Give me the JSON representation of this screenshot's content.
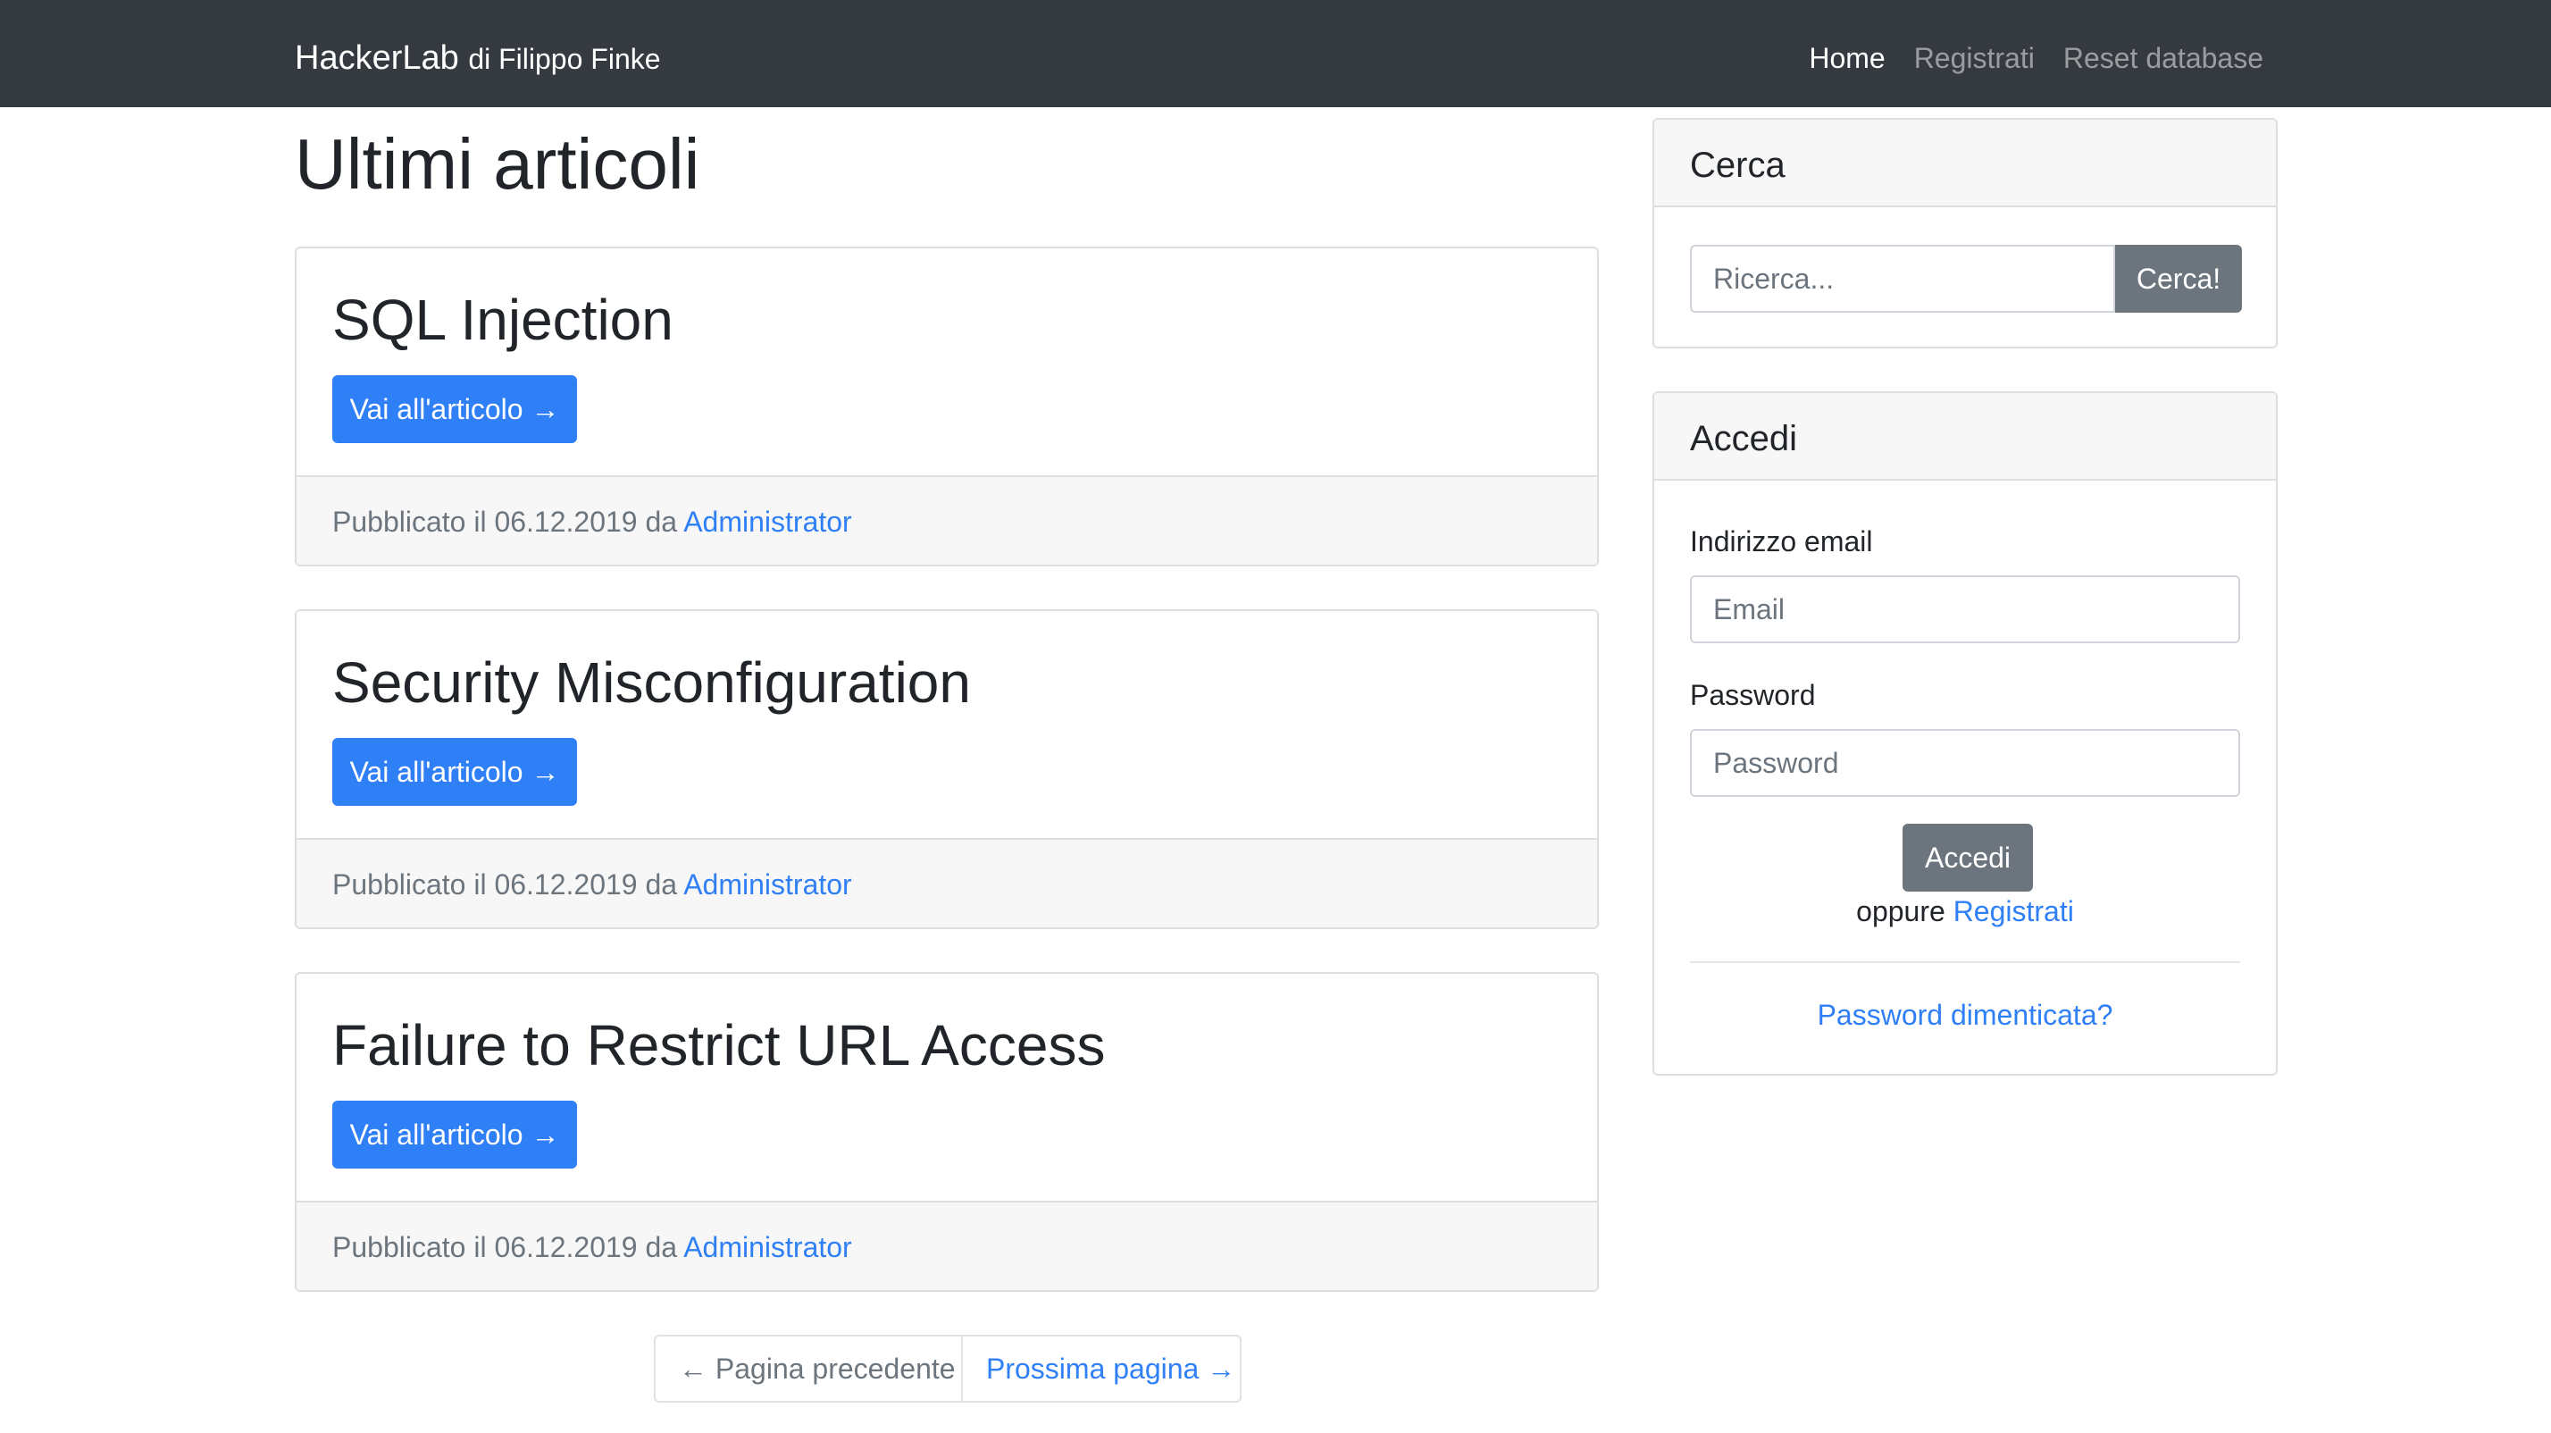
{
  "navbar": {
    "brand": "HackerLab",
    "brand_sub": "di Filippo Finke",
    "links": [
      {
        "label": "Home"
      },
      {
        "label": "Registrati"
      },
      {
        "label": "Reset database"
      }
    ]
  },
  "main": {
    "title": "Ultimi articoli",
    "posts": [
      {
        "title": "SQL Injection",
        "button": "Vai all'articolo →",
        "published_prefix": "Pubblicato il 06.12.2019 da",
        "author": "Administrator"
      },
      {
        "title": "Security Misconfiguration",
        "button": "Vai all'articolo →",
        "published_prefix": "Pubblicato il 06.12.2019 da",
        "author": "Administrator"
      },
      {
        "title": "Failure to Restrict URL Access",
        "button": "Vai all'articolo →",
        "published_prefix": "Pubblicato il 06.12.2019 da",
        "author": "Administrator"
      }
    ],
    "pagination": {
      "prev": "← Pagina precedente",
      "next": "Prossima pagina →"
    }
  },
  "sidebar": {
    "search": {
      "header": "Cerca",
      "placeholder": "Ricerca...",
      "button": "Cerca!"
    },
    "login": {
      "header": "Accedi",
      "email_label": "Indirizzo email",
      "email_placeholder": "Email",
      "password_label": "Password",
      "password_placeholder": "Password",
      "button": "Accedi",
      "alt_prefix": "oppure",
      "alt_link": "Registrati",
      "forgot": "Password dimenticata?"
    }
  },
  "colors": {
    "navbar": "#343a40",
    "primary": "#2f7ff6",
    "secondary": "#6c757d"
  }
}
